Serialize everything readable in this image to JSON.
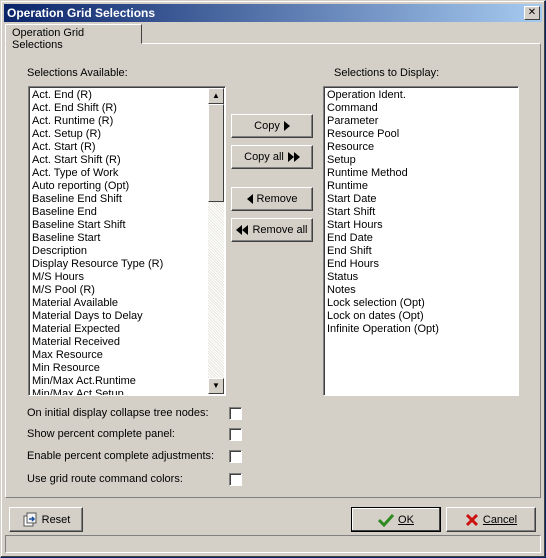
{
  "window": {
    "title": "Operation Grid Selections",
    "close_glyph": "✕"
  },
  "tab": {
    "label": "Operation Grid Selections"
  },
  "available": {
    "label": "Selections Available:",
    "items": [
      "Act. End (R)",
      "Act. End Shift (R)",
      "Act. Runtime (R)",
      "Act. Setup (R)",
      "Act. Start (R)",
      "Act. Start Shift (R)",
      "Act. Type of Work",
      "Auto reporting (Opt)",
      "Baseline End Shift",
      "Baseline End",
      "Baseline Start Shift",
      "Baseline Start",
      "Description",
      "Display Resource Type (R)",
      "M/S Hours",
      "M/S Pool (R)",
      "Material Available",
      "Material Days to Delay",
      "Material Expected",
      "Material Received",
      "Max Resource",
      "Min Resource",
      "Min/Max Act.Runtime",
      "Min/Max Act.Setup"
    ]
  },
  "display": {
    "label": "Selections to Display:",
    "items": [
      "Operation Ident.",
      "Command",
      "Parameter",
      "Resource Pool",
      "Resource",
      "Setup",
      "Runtime Method",
      "Runtime",
      "Start Date",
      "Start Shift",
      "Start Hours",
      "End Date",
      "End Shift",
      "End Hours",
      "Status",
      "Notes",
      "Lock selection (Opt)",
      "Lock on dates (Opt)",
      "Infinite Operation (Opt)"
    ]
  },
  "buttons": {
    "copy": "Copy",
    "copy_all": "Copy all",
    "remove": "Remove",
    "remove_all": "Remove all",
    "reset": "Reset",
    "ok": "OK",
    "cancel": "Cancel"
  },
  "options": [
    {
      "label": "On initial display collapse tree nodes:",
      "checked": false
    },
    {
      "label": "Show percent complete panel:",
      "checked": false
    },
    {
      "label": "Enable percent complete adjustments:",
      "checked": false
    },
    {
      "label": "Use grid route command colors:",
      "checked": false
    }
  ],
  "colors": {
    "title_bar": "#0a246a",
    "ok_check": "#2e8b22",
    "cancel_x": "#cc1111"
  }
}
